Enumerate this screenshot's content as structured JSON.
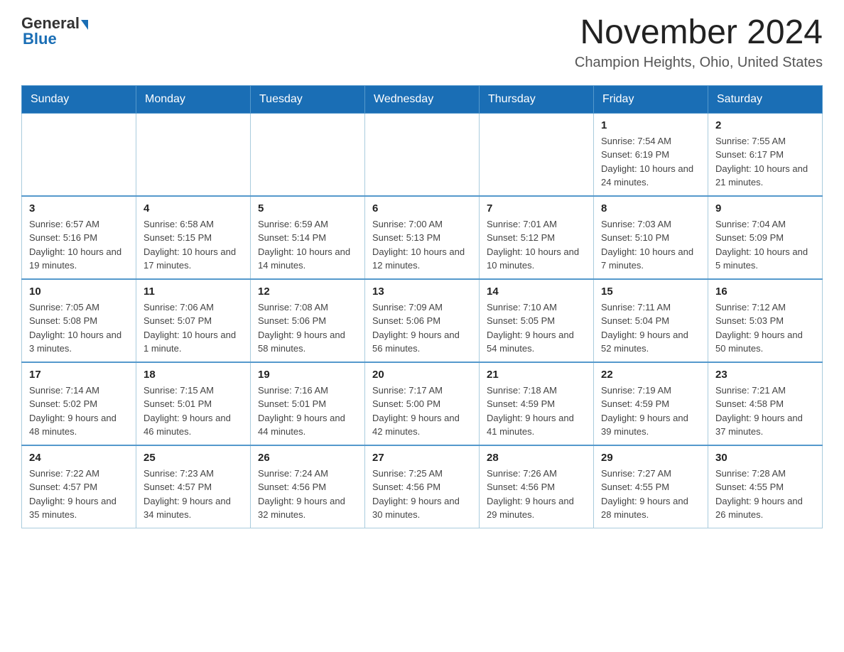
{
  "header": {
    "logo_general": "General",
    "logo_blue": "Blue",
    "month_title": "November 2024",
    "location": "Champion Heights, Ohio, United States"
  },
  "weekdays": [
    "Sunday",
    "Monday",
    "Tuesday",
    "Wednesday",
    "Thursday",
    "Friday",
    "Saturday"
  ],
  "weeks": [
    [
      {
        "day": "",
        "sunrise": "",
        "sunset": "",
        "daylight": ""
      },
      {
        "day": "",
        "sunrise": "",
        "sunset": "",
        "daylight": ""
      },
      {
        "day": "",
        "sunrise": "",
        "sunset": "",
        "daylight": ""
      },
      {
        "day": "",
        "sunrise": "",
        "sunset": "",
        "daylight": ""
      },
      {
        "day": "",
        "sunrise": "",
        "sunset": "",
        "daylight": ""
      },
      {
        "day": "1",
        "sunrise": "Sunrise: 7:54 AM",
        "sunset": "Sunset: 6:19 PM",
        "daylight": "Daylight: 10 hours and 24 minutes."
      },
      {
        "day": "2",
        "sunrise": "Sunrise: 7:55 AM",
        "sunset": "Sunset: 6:17 PM",
        "daylight": "Daylight: 10 hours and 21 minutes."
      }
    ],
    [
      {
        "day": "3",
        "sunrise": "Sunrise: 6:57 AM",
        "sunset": "Sunset: 5:16 PM",
        "daylight": "Daylight: 10 hours and 19 minutes."
      },
      {
        "day": "4",
        "sunrise": "Sunrise: 6:58 AM",
        "sunset": "Sunset: 5:15 PM",
        "daylight": "Daylight: 10 hours and 17 minutes."
      },
      {
        "day": "5",
        "sunrise": "Sunrise: 6:59 AM",
        "sunset": "Sunset: 5:14 PM",
        "daylight": "Daylight: 10 hours and 14 minutes."
      },
      {
        "day": "6",
        "sunrise": "Sunrise: 7:00 AM",
        "sunset": "Sunset: 5:13 PM",
        "daylight": "Daylight: 10 hours and 12 minutes."
      },
      {
        "day": "7",
        "sunrise": "Sunrise: 7:01 AM",
        "sunset": "Sunset: 5:12 PM",
        "daylight": "Daylight: 10 hours and 10 minutes."
      },
      {
        "day": "8",
        "sunrise": "Sunrise: 7:03 AM",
        "sunset": "Sunset: 5:10 PM",
        "daylight": "Daylight: 10 hours and 7 minutes."
      },
      {
        "day": "9",
        "sunrise": "Sunrise: 7:04 AM",
        "sunset": "Sunset: 5:09 PM",
        "daylight": "Daylight: 10 hours and 5 minutes."
      }
    ],
    [
      {
        "day": "10",
        "sunrise": "Sunrise: 7:05 AM",
        "sunset": "Sunset: 5:08 PM",
        "daylight": "Daylight: 10 hours and 3 minutes."
      },
      {
        "day": "11",
        "sunrise": "Sunrise: 7:06 AM",
        "sunset": "Sunset: 5:07 PM",
        "daylight": "Daylight: 10 hours and 1 minute."
      },
      {
        "day": "12",
        "sunrise": "Sunrise: 7:08 AM",
        "sunset": "Sunset: 5:06 PM",
        "daylight": "Daylight: 9 hours and 58 minutes."
      },
      {
        "day": "13",
        "sunrise": "Sunrise: 7:09 AM",
        "sunset": "Sunset: 5:06 PM",
        "daylight": "Daylight: 9 hours and 56 minutes."
      },
      {
        "day": "14",
        "sunrise": "Sunrise: 7:10 AM",
        "sunset": "Sunset: 5:05 PM",
        "daylight": "Daylight: 9 hours and 54 minutes."
      },
      {
        "day": "15",
        "sunrise": "Sunrise: 7:11 AM",
        "sunset": "Sunset: 5:04 PM",
        "daylight": "Daylight: 9 hours and 52 minutes."
      },
      {
        "day": "16",
        "sunrise": "Sunrise: 7:12 AM",
        "sunset": "Sunset: 5:03 PM",
        "daylight": "Daylight: 9 hours and 50 minutes."
      }
    ],
    [
      {
        "day": "17",
        "sunrise": "Sunrise: 7:14 AM",
        "sunset": "Sunset: 5:02 PM",
        "daylight": "Daylight: 9 hours and 48 minutes."
      },
      {
        "day": "18",
        "sunrise": "Sunrise: 7:15 AM",
        "sunset": "Sunset: 5:01 PM",
        "daylight": "Daylight: 9 hours and 46 minutes."
      },
      {
        "day": "19",
        "sunrise": "Sunrise: 7:16 AM",
        "sunset": "Sunset: 5:01 PM",
        "daylight": "Daylight: 9 hours and 44 minutes."
      },
      {
        "day": "20",
        "sunrise": "Sunrise: 7:17 AM",
        "sunset": "Sunset: 5:00 PM",
        "daylight": "Daylight: 9 hours and 42 minutes."
      },
      {
        "day": "21",
        "sunrise": "Sunrise: 7:18 AM",
        "sunset": "Sunset: 4:59 PM",
        "daylight": "Daylight: 9 hours and 41 minutes."
      },
      {
        "day": "22",
        "sunrise": "Sunrise: 7:19 AM",
        "sunset": "Sunset: 4:59 PM",
        "daylight": "Daylight: 9 hours and 39 minutes."
      },
      {
        "day": "23",
        "sunrise": "Sunrise: 7:21 AM",
        "sunset": "Sunset: 4:58 PM",
        "daylight": "Daylight: 9 hours and 37 minutes."
      }
    ],
    [
      {
        "day": "24",
        "sunrise": "Sunrise: 7:22 AM",
        "sunset": "Sunset: 4:57 PM",
        "daylight": "Daylight: 9 hours and 35 minutes."
      },
      {
        "day": "25",
        "sunrise": "Sunrise: 7:23 AM",
        "sunset": "Sunset: 4:57 PM",
        "daylight": "Daylight: 9 hours and 34 minutes."
      },
      {
        "day": "26",
        "sunrise": "Sunrise: 7:24 AM",
        "sunset": "Sunset: 4:56 PM",
        "daylight": "Daylight: 9 hours and 32 minutes."
      },
      {
        "day": "27",
        "sunrise": "Sunrise: 7:25 AM",
        "sunset": "Sunset: 4:56 PM",
        "daylight": "Daylight: 9 hours and 30 minutes."
      },
      {
        "day": "28",
        "sunrise": "Sunrise: 7:26 AM",
        "sunset": "Sunset: 4:56 PM",
        "daylight": "Daylight: 9 hours and 29 minutes."
      },
      {
        "day": "29",
        "sunrise": "Sunrise: 7:27 AM",
        "sunset": "Sunset: 4:55 PM",
        "daylight": "Daylight: 9 hours and 28 minutes."
      },
      {
        "day": "30",
        "sunrise": "Sunrise: 7:28 AM",
        "sunset": "Sunset: 4:55 PM",
        "daylight": "Daylight: 9 hours and 26 minutes."
      }
    ]
  ]
}
